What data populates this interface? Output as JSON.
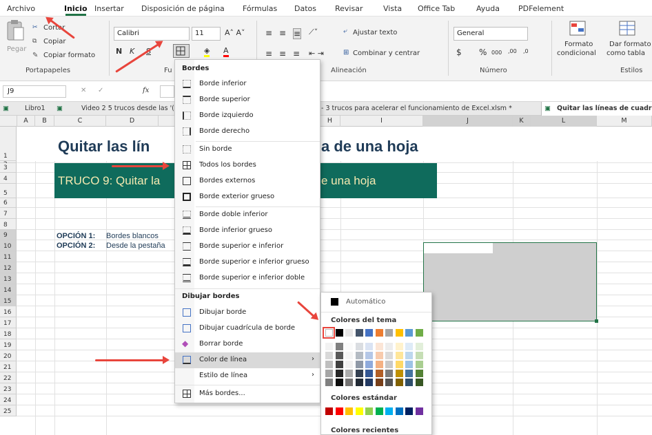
{
  "menubar": {
    "tabs": [
      "Archivo",
      "Inicio",
      "Insertar",
      "Disposición de página",
      "Fórmulas",
      "Datos",
      "Revisar",
      "Vista",
      "Office Tab",
      "Ayuda",
      "PDFelement"
    ],
    "active": "Inicio"
  },
  "ribbon": {
    "clipboard": {
      "paste": "Pegar",
      "cut": "Cortar",
      "copy": "Copiar",
      "copy_format": "Copiar formato",
      "group": "Portapapeles"
    },
    "font": {
      "name": "Calibri",
      "size": "11",
      "bold": "N",
      "italic": "K",
      "underline": "S",
      "group": "Fu"
    },
    "alignment": {
      "wrap": "Ajustar texto",
      "merge": "Combinar y centrar",
      "group": "Alineación"
    },
    "number": {
      "format": "General",
      "currency": "$",
      "percent": "%",
      "thousands": "000",
      "inc": ",00",
      "dec": ",0",
      "group": "Número"
    },
    "styles": {
      "conditional": "Formato",
      "conditional2": "condicional",
      "table": "Dar formato",
      "table2": "como tabla",
      "group": "Estilos"
    }
  },
  "formula": {
    "name_box": "J9",
    "fx": "fx"
  },
  "workbook_tabs": [
    "Libro1",
    "Video 2 5 trucos desde las '(",
    "- 3 trucos para acelerar el funcionamiento de Excel.xlsm *",
    "Quitar las líneas de cuadrícu"
  ],
  "columns": [
    "A",
    "B",
    "C",
    "D",
    "H",
    "I",
    "J",
    "K",
    "L",
    "M"
  ],
  "rows": [
    "1",
    "2",
    "3",
    "4",
    "5",
    "6",
    "7",
    "8",
    "9",
    "10",
    "11",
    "12",
    "13",
    "14",
    "15",
    "16",
    "17",
    "18",
    "19",
    "20",
    "21",
    "22",
    "23",
    "24",
    "25"
  ],
  "sheet": {
    "title_left": "Quitar las lín",
    "title_right": "a de una hoja",
    "banner_left": "TRUCO 9: Quitar la",
    "banner_right": "e una hoja",
    "opt1_label": "OPCIÓN 1:",
    "opt1_text": "Bordes blancos",
    "opt2_label": "OPCIÓN 2:",
    "opt2_text": "Desde la pestaña"
  },
  "borders_menu": {
    "header": "Bordes",
    "items": [
      "Borde inferior",
      "Borde superior",
      "Borde izquierdo",
      "Borde derecho",
      "Sin borde",
      "Todos los bordes",
      "Bordes externos",
      "Borde exterior grueso",
      "Borde doble inferior",
      "Borde inferior grueso",
      "Borde superior e inferior",
      "Borde superior e inferior grueso",
      "Borde superior e inferior doble"
    ],
    "draw_header": "Dibujar bordes",
    "draw_items": [
      "Dibujar borde",
      "Dibujar cuadrícula de borde",
      "Borrar borde",
      "Color de línea",
      "Estilo de línea",
      "Más bordes..."
    ]
  },
  "palette": {
    "automatic": "Automático",
    "theme_label": "Colores del tema",
    "standard_label": "Colores estándar",
    "recent_label": "Colores recientes",
    "theme_top": [
      "#ffffff",
      "#000000",
      "#e7e6e6",
      "#44546a",
      "#4472c4",
      "#ed7d31",
      "#a5a5a5",
      "#ffc000",
      "#5b9bd5",
      "#70ad47"
    ],
    "standard": [
      "#c00000",
      "#ff0000",
      "#ffc000",
      "#ffff00",
      "#92d050",
      "#00b050",
      "#00b0f0",
      "#0070c0",
      "#002060",
      "#7030a0"
    ]
  },
  "colors": {
    "accent": "#217346",
    "banner": "#0f6b5c",
    "arrow": "#e8453c",
    "selection_fill": "#cfcfcf"
  }
}
